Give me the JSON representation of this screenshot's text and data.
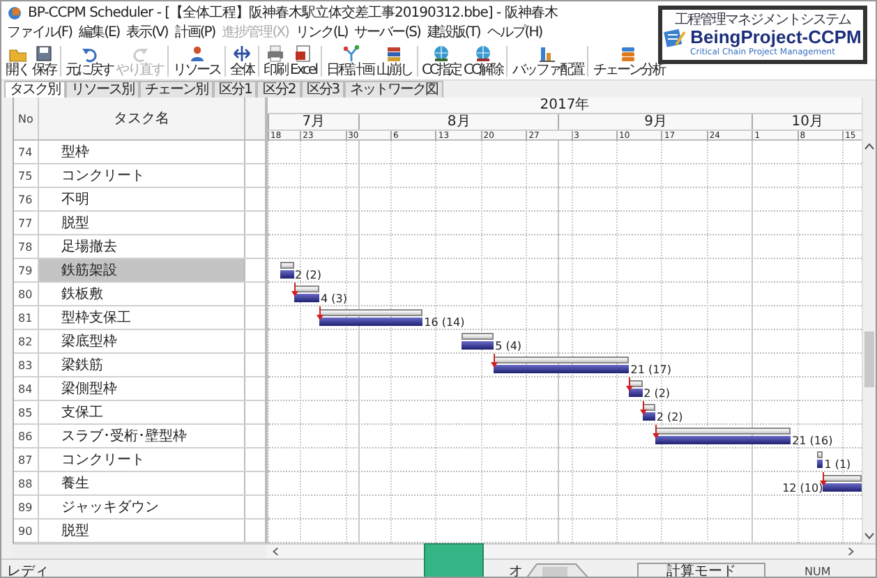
{
  "window": {
    "title": "BP-CCPM Scheduler - [【全体工程】阪神春木駅立体交差工事20190312.bbe] - 阪神春木"
  },
  "menu": [
    {
      "label": "ファイル(F)",
      "disabled": false
    },
    {
      "label": "編集(E)",
      "disabled": false
    },
    {
      "label": "表示(V)",
      "disabled": false
    },
    {
      "label": "計画(P)",
      "disabled": false
    },
    {
      "label": "進捗管理(X)",
      "disabled": true
    },
    {
      "label": "リンク(L)",
      "disabled": false
    },
    {
      "label": "サーバー(S)",
      "disabled": false
    },
    {
      "label": "建設版(T)",
      "disabled": false
    },
    {
      "label": "ヘルプ(H)",
      "disabled": false
    }
  ],
  "toolbar": [
    {
      "label": "開く",
      "disabled": false,
      "separator": false
    },
    {
      "label": "保存",
      "disabled": false,
      "separator": false
    },
    {
      "label": "元に戻す",
      "disabled": false,
      "separator": true
    },
    {
      "label": "やり直す",
      "disabled": true,
      "separator": false
    },
    {
      "label": "リソース",
      "disabled": false,
      "separator": true
    },
    {
      "label": "全体",
      "disabled": false,
      "separator": true
    },
    {
      "label": "印刷",
      "disabled": false,
      "separator": true
    },
    {
      "label": "Excel",
      "disabled": false,
      "separator": false
    },
    {
      "label": "日程計画",
      "disabled": false,
      "separator": true
    },
    {
      "label": "山崩し",
      "disabled": false,
      "separator": false
    },
    {
      "label": "CC指定",
      "disabled": false,
      "separator": true
    },
    {
      "label": "CC解除",
      "disabled": false,
      "separator": false
    },
    {
      "label": "バッファ配置",
      "disabled": false,
      "separator": true
    },
    {
      "label": "チェーン分析",
      "disabled": false,
      "separator": true
    }
  ],
  "logo": {
    "tagline": "工程管理マネジメントシステム",
    "name": "BeingProject-CCPM",
    "subtitle": "Critical Chain Project Management"
  },
  "tabs": [
    {
      "label": "タスク別",
      "selected": true
    },
    {
      "label": "リソース別",
      "selected": false
    },
    {
      "label": "チェーン別",
      "selected": false
    },
    {
      "label": "区分1",
      "selected": false
    },
    {
      "label": "区分2",
      "selected": false
    },
    {
      "label": "区分3",
      "selected": false
    },
    {
      "label": "ネットワーク図",
      "selected": false
    }
  ],
  "table": {
    "columns": [
      "No",
      "タスク名"
    ]
  },
  "tasks": [
    {
      "no": "74",
      "name": "型枠",
      "selected": false
    },
    {
      "no": "75",
      "name": "コンクリート",
      "selected": false
    },
    {
      "no": "76",
      "name": "不明",
      "selected": false
    },
    {
      "no": "77",
      "name": "脱型",
      "selected": false
    },
    {
      "no": "78",
      "name": "足場撤去",
      "selected": false
    },
    {
      "no": "79",
      "name": "鉄筋架設",
      "selected": true,
      "bar": {
        "label": "2 (2)",
        "linked": false
      }
    },
    {
      "no": "80",
      "name": "鉄板敷",
      "selected": false,
      "bar": {
        "label": "4 (3)",
        "linked": true
      }
    },
    {
      "no": "81",
      "name": "型枠支保工",
      "selected": false,
      "bar": {
        "label": "16 (14)",
        "linked": true
      }
    },
    {
      "no": "82",
      "name": "梁底型枠",
      "selected": false,
      "bar": {
        "label": "5 (4)",
        "linked": false
      }
    },
    {
      "no": "83",
      "name": "梁鉄筋",
      "selected": false,
      "bar": {
        "label": "21 (17)",
        "linked": true
      }
    },
    {
      "no": "84",
      "name": "梁側型枠",
      "selected": false,
      "bar": {
        "label": "2 (2)",
        "linked": true
      }
    },
    {
      "no": "85",
      "name": "支保工",
      "selected": false,
      "bar": {
        "label": "2 (2)",
        "linked": true
      }
    },
    {
      "no": "86",
      "name": "スラブ･受桁･壁型枠",
      "selected": false,
      "bar": {
        "label": "21 (16)",
        "linked": true
      }
    },
    {
      "no": "87",
      "name": "コンクリート",
      "selected": false,
      "bar": {
        "label": "1 (1)",
        "linked": false
      }
    },
    {
      "no": "88",
      "name": "養生",
      "selected": false,
      "bar": {
        "label": "12 (10)",
        "linked": true
      }
    },
    {
      "no": "89",
      "name": "ジャッキダウン",
      "selected": false
    },
    {
      "no": "90",
      "name": "脱型",
      "selected": false
    }
  ],
  "gantt": {
    "year": "2017年",
    "months": [
      "7月",
      "8月",
      "9月",
      "10月"
    ],
    "days": [
      "18",
      "23",
      "30",
      "6",
      "13",
      "20",
      "27",
      "3",
      "10",
      "17",
      "24",
      "1",
      "8",
      "15"
    ]
  },
  "status_bar": {
    "message": "レディ",
    "partial": "オ",
    "mode": "計算モード",
    "num": "NUM"
  }
}
